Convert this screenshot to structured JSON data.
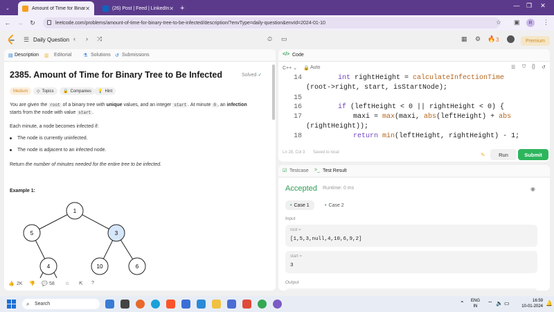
{
  "browser": {
    "tabs": [
      {
        "title": "Amount of Time for Binary Tre",
        "active": true
      },
      {
        "title": "(26) Post | Feed | LinkedIn",
        "active": false
      }
    ],
    "new_tab": "+",
    "url": "leetcode.com/problems/amount-of-time-for-binary-tree-to-be-infected/description/?envType=daily-question&envId=2024-01-10",
    "profile_initial": "R"
  },
  "header": {
    "daily_question": "Daily Question",
    "streak": "3",
    "premium": "Premium"
  },
  "problem": {
    "tabs": [
      "Description",
      "Editorial",
      "Solutions",
      "Submissions"
    ],
    "title": "2385. Amount of Time for Binary Tree to Be Infected",
    "status": "Solved",
    "difficulty": "Medium",
    "chips": [
      "Topics",
      "Companies",
      "Hint"
    ],
    "p1_a": "You are given the ",
    "p1_root": "root",
    "p1_b": " of a binary tree with ",
    "p1_unique": "unique",
    "p1_c": " values, and an integer ",
    "p1_start": "start",
    "p1_d": ". At minute ",
    "p1_zero": "0",
    "p1_e": ", an ",
    "p1_infection": "infection",
    "p1_f": "starts from the node with value ",
    "p1_start2": "start",
    "p1_g": ".",
    "p2": "Each minute, a node becomes infected if:",
    "bullets": [
      "The node is currently uninfected.",
      "The node is adjacent to an infected node."
    ],
    "p3_a": "Return ",
    "p3_b": "the number of minutes needed for the entire tree to be infected.",
    "example_label": "Example 1:",
    "tree_nodes": [
      "1",
      "5",
      "3",
      "4",
      "10",
      "6"
    ],
    "likes": "2K",
    "comments": "58"
  },
  "code": {
    "title": "Code",
    "language": "C++",
    "mode": "Auto",
    "lines": [
      {
        "num": "14",
        "text": "int rightHeight = calculateInfectionTime"
      },
      {
        "num": "",
        "text": "(root->right, start, isStartNode);"
      },
      {
        "num": "15",
        "text": ""
      },
      {
        "num": "16",
        "text": "if (leftHeight < 0 || rightHeight < 0) {"
      },
      {
        "num": "17",
        "text": "maxi = max(maxi, abs(leftHeight) + abs"
      },
      {
        "num": "",
        "text": "(rightHeight));"
      },
      {
        "num": "18",
        "text": "return min(leftHeight, rightHeight) - 1;"
      }
    ],
    "status": "Ln 28, Col 3",
    "saved": "Saved to local",
    "run": "Run",
    "submit": "Submit"
  },
  "result": {
    "tabs": [
      "Testcase",
      "Test Result"
    ],
    "verdict": "Accepted",
    "runtime": "Runtime: 0 ms",
    "cases": [
      "Case 1",
      "Case 2"
    ],
    "input_label": "Input",
    "root_key": "root =",
    "root_val": "[1,5,3,null,4,10,6,9,2]",
    "start_key": "start =",
    "start_val": "3",
    "output_label": "Output"
  },
  "taskbar": {
    "search": "Search",
    "lang_top": "ENG",
    "lang_bottom": "IN",
    "time": "16:59",
    "date": "10-01-2024"
  },
  "colors": {
    "tabbar": "#5b3a8c",
    "accepted": "#2e9e53",
    "submit": "#2db55d",
    "medium": "#d08b25"
  }
}
